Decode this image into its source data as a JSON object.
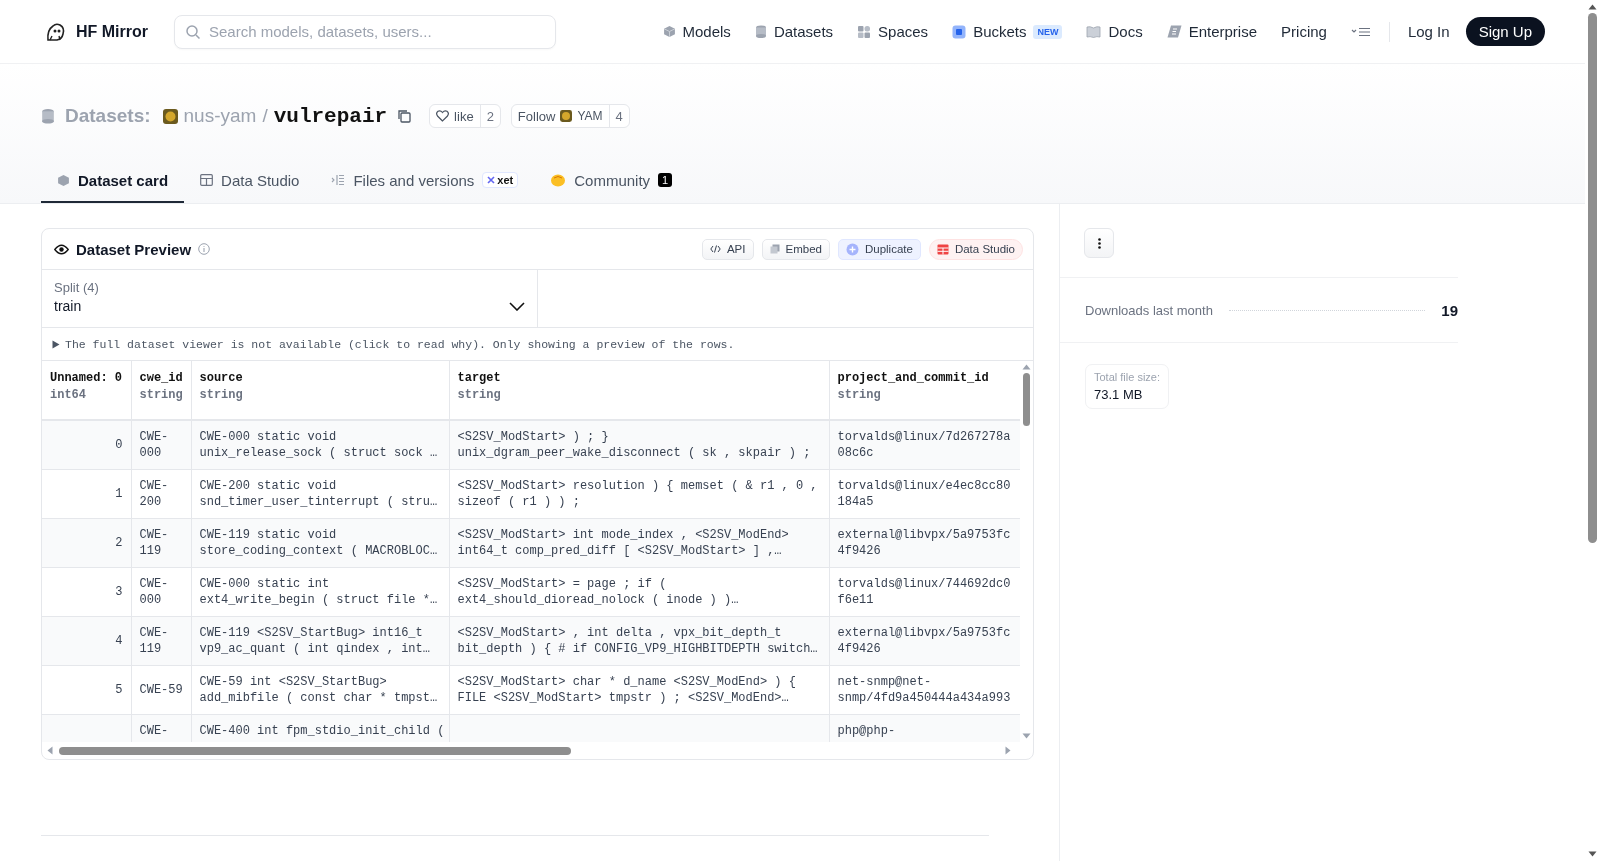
{
  "header": {
    "brand": "HF Mirror",
    "search": {
      "placeholder": "Search models, datasets, users..."
    },
    "nav": [
      {
        "label": "Models",
        "kind": "cube"
      },
      {
        "label": "Datasets",
        "kind": "db"
      },
      {
        "label": "Spaces",
        "kind": "grid"
      },
      {
        "label": "Buckets",
        "kind": "bucket",
        "badge": "NEW"
      },
      {
        "label": "Docs",
        "kind": "book"
      },
      {
        "label": "Enterprise",
        "kind": "ent"
      },
      {
        "label": "Pricing",
        "kind": "plain"
      }
    ],
    "login": "Log In",
    "signup": "Sign Up"
  },
  "repo": {
    "type": "Datasets:",
    "owner": "nus-yam",
    "sep": "/",
    "name": "vulrepair",
    "like": {
      "label": "like",
      "count": "2"
    },
    "follow": {
      "label": "Follow",
      "org": "YAM",
      "count": "4"
    }
  },
  "tabs": [
    {
      "label": "Dataset card",
      "kind": "card",
      "selected": true
    },
    {
      "label": "Data Studio",
      "kind": "table",
      "selected": false
    },
    {
      "label": "Files and versions",
      "kind": "files",
      "badge": "xet",
      "selected": false
    },
    {
      "label": "Community",
      "kind": "community",
      "count": "1",
      "selected": false
    }
  ],
  "preview": {
    "title": "Dataset Preview",
    "actions": [
      {
        "label": "API",
        "kind": "api"
      },
      {
        "label": "Embed",
        "kind": "embed"
      },
      {
        "label": "Duplicate",
        "kind": "duplicate"
      },
      {
        "label": "Data Studio",
        "kind": "studio"
      }
    ],
    "split": {
      "label": "Split (4)",
      "value": "train"
    },
    "notice": "The full dataset viewer is not available (click to read why). Only showing a preview of the rows.",
    "columns": [
      {
        "name": "Unnamed: 0",
        "type": "int64"
      },
      {
        "name": "cwe_id",
        "type": "string"
      },
      {
        "name": "source",
        "type": "string"
      },
      {
        "name": "target",
        "type": "string"
      },
      {
        "name": "project_and_commit_id",
        "type": "string"
      }
    ],
    "rows": [
      [
        "0",
        "CWE-\n000",
        "CWE-000 static void\nunix_release_sock ( struct sock …",
        "<S2SV_ModStart> ) ; }\nunix_dgram_peer_wake_disconnect ( sk , skpair ) ;",
        "torvalds@linux/7d267278a\n08c6c"
      ],
      [
        "1",
        "CWE-\n200",
        "CWE-200 static void\nsnd_timer_user_tinterrupt ( stru…",
        "<S2SV_ModStart> resolution ) { memset ( & r1 , 0 ,\nsizeof ( r1 ) ) ;",
        "torvalds@linux/e4ec8cc80\n184a5"
      ],
      [
        "2",
        "CWE-\n119",
        "CWE-119 static void\nstore_coding_context ( MACROBLOC…",
        "<S2SV_ModStart> int mode_index , <S2SV_ModEnd>\nint64_t comp_pred_diff [ <S2SV_ModStart> ] ,…",
        "external@libvpx/5a9753fc\n4f9426"
      ],
      [
        "3",
        "CWE-\n000",
        "CWE-000 static int\next4_write_begin ( struct file *…",
        "<S2SV_ModStart> = page ; if (\next4_should_dioread_nolock ( inode ) )…",
        "torvalds@linux/744692dc0\nf6e11"
      ],
      [
        "4",
        "CWE-\n119",
        "CWE-119 <S2SV_StartBug> int16_t\nvp9_ac_quant ( int qindex , int…",
        "<S2SV_ModStart> , int delta , vpx_bit_depth_t\nbit_depth ) { # if CONFIG_VP9_HIGHBITDEPTH switch…",
        "external@libvpx/5a9753fc\n4f9426"
      ],
      [
        "5",
        "CWE-59",
        "CWE-59 int <S2SV_StartBug>\nadd_mibfile ( const char * tmpst…",
        "<S2SV_ModStart> char * d_name <S2SV_ModEnd> ) {\nFILE <S2SV_ModStart> tmpstr ) ; <S2SV_ModEnd>…",
        "net-snmp@net-\nsnmp/4fd9a450444a434a993"
      ],
      [
        "",
        "CWE-",
        "CWE-400 int fpm_stdio_init_child (",
        "",
        "php@php-"
      ]
    ]
  },
  "stats": {
    "downloads_label": "Downloads last month",
    "downloads": "19",
    "size_label": "Total file size:",
    "size": "73.1 MB"
  }
}
